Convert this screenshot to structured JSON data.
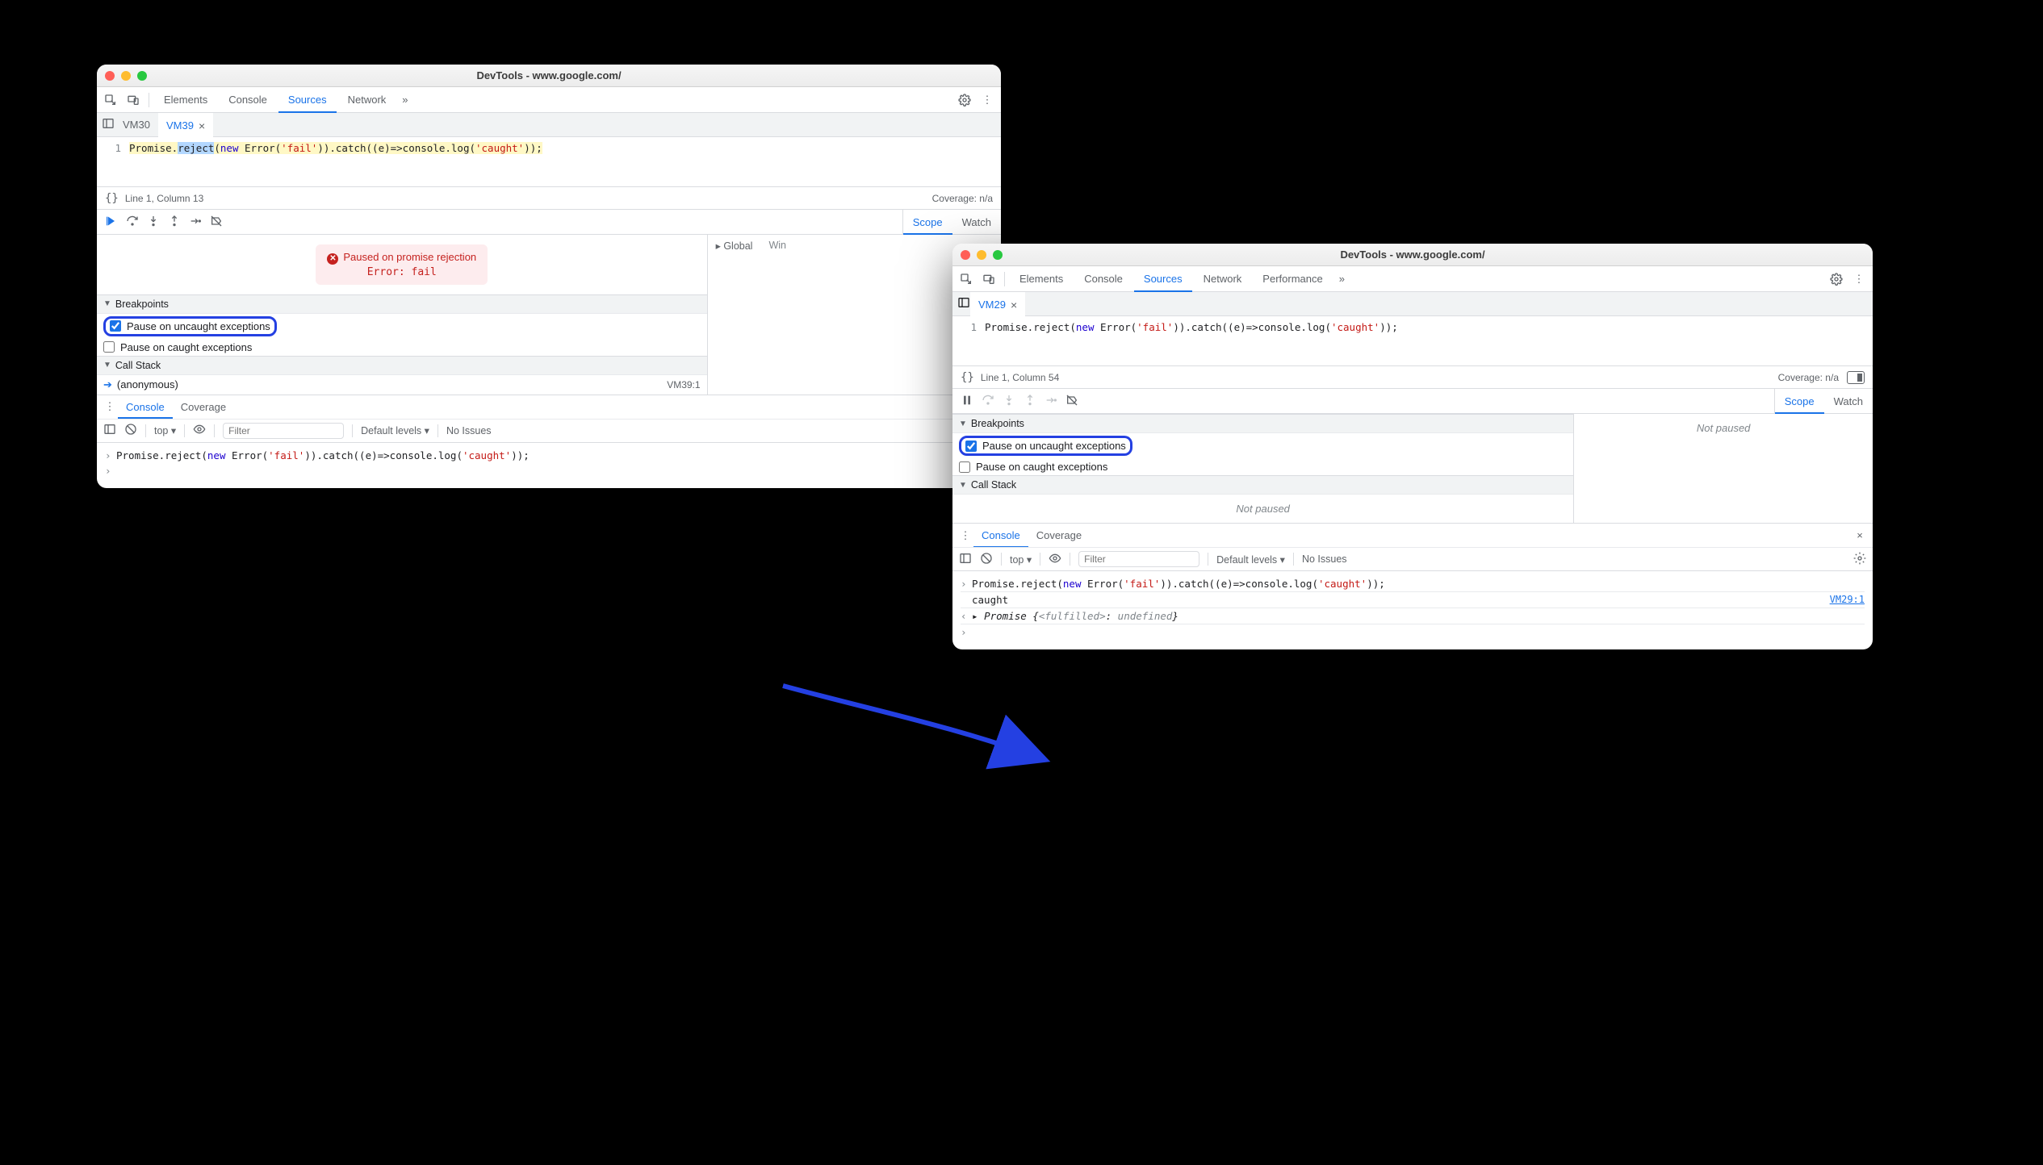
{
  "windowA": {
    "title": "DevTools - www.google.com/",
    "mainTabs": [
      "Elements",
      "Console",
      "Sources",
      "Network"
    ],
    "activeMainTab": "Sources",
    "moreTabs": "»",
    "fileTabs": {
      "inactive": "VM30",
      "active": "VM39"
    },
    "code": {
      "lineNo": "1",
      "pre": "Promise.",
      "sel": "reject",
      "post1": "(",
      "kw_new": "new",
      "post2": " Error(",
      "str1": "'fail'",
      "post3": ")).catch((e)=>console.log(",
      "str2": "'caught'",
      "post4": "));"
    },
    "status": {
      "linecol": "Line 1, Column 13",
      "coverage": "Coverage: n/a"
    },
    "scopeTabs": {
      "scope": "Scope",
      "watch": "Watch"
    },
    "scopeBody": {
      "global": "Global",
      "win": "Win"
    },
    "pauseBanner": {
      "msg": "Paused on promise rejection",
      "err": "Error: fail"
    },
    "sections": {
      "breakpoints": "Breakpoints",
      "callstack": "Call Stack"
    },
    "bp": {
      "uncaught": "Pause on uncaught exceptions",
      "caught": "Pause on caught exceptions"
    },
    "stack": {
      "name": "(anonymous)",
      "loc": "VM39:1"
    },
    "drawer": {
      "console": "Console",
      "coverage": "Coverage"
    },
    "consoleTb": {
      "top": "top",
      "filterPh": "Filter",
      "levels": "Default levels",
      "issues": "No Issues"
    },
    "consoleLine": {
      "pre": "Promise.reject(",
      "kw_new": "new",
      "post2": " Error(",
      "str1": "'fail'",
      "post3": ")).catch((e)=>console.log(",
      "str2": "'caught'",
      "post4": "));"
    }
  },
  "windowB": {
    "title": "DevTools - www.google.com/",
    "mainTabs": [
      "Elements",
      "Console",
      "Sources",
      "Network",
      "Performance"
    ],
    "activeMainTab": "Sources",
    "moreTabs": "»",
    "fileTabs": {
      "active": "VM29"
    },
    "code": {
      "lineNo": "1",
      "pre": "Promise.reject(",
      "kw_new": "new",
      "post2": " Error(",
      "str1": "'fail'",
      "post3": ")).catch((e)=>console.log(",
      "str2": "'caught'",
      "post4": "));"
    },
    "status": {
      "linecol": "Line 1, Column 54",
      "coverage": "Coverage: n/a"
    },
    "scopeTabs": {
      "scope": "Scope",
      "watch": "Watch"
    },
    "scopeNotPaused": "Not paused",
    "sections": {
      "breakpoints": "Breakpoints",
      "callstack": "Call Stack"
    },
    "bp": {
      "uncaught": "Pause on uncaught exceptions",
      "caught": "Pause on caught exceptions"
    },
    "stackNotPaused": "Not paused",
    "drawer": {
      "console": "Console",
      "coverage": "Coverage"
    },
    "consoleTb": {
      "top": "top",
      "filterPh": "Filter",
      "levels": "Default levels",
      "issues": "No Issues"
    },
    "consoleLines": {
      "line1": {
        "pre": "Promise.reject(",
        "kw_new": "new",
        "post2": " Error(",
        "str1": "'fail'",
        "post3": ")).catch((e)=>console.log(",
        "str2": "'caught'",
        "post4": "));"
      },
      "line2": {
        "text": "caught",
        "link": "VM29:1"
      },
      "line3": {
        "promise": "Promise ",
        "open": "{",
        "fulfilled": "<fulfilled>",
        "colon": ": ",
        "undef": "undefined",
        "close": "}"
      }
    }
  }
}
